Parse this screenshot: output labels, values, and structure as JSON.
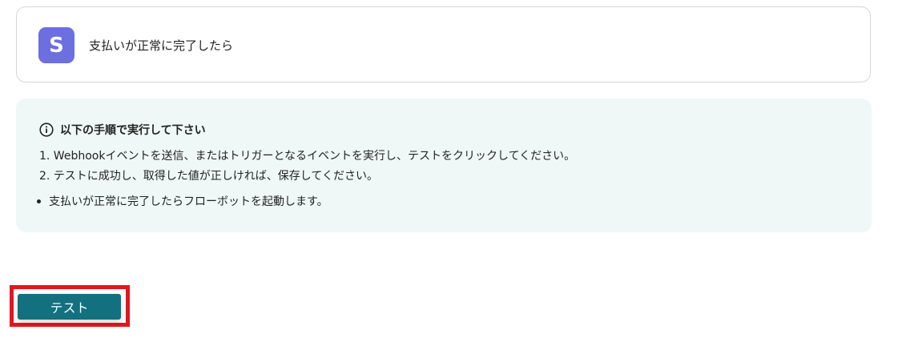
{
  "trigger": {
    "icon_letter": "S",
    "icon_color": "#6d6ee0",
    "label": "支払いが正常に完了したら"
  },
  "instructions": {
    "heading": "以下の手順で実行して下さい",
    "icon": "info-icon",
    "steps": [
      "1. Webhookイベントを送信、またはトリガーとなるイベントを実行し、テストをクリックしてください。",
      "2. テストに成功し、取得した値が正しければ、保存してください。"
    ],
    "bullets": [
      "支払いが正常に完了したらフローボットを起動します。"
    ]
  },
  "actions": {
    "test_label": "テスト",
    "button_color": "#12707f",
    "highlight_color": "#e6141f"
  }
}
